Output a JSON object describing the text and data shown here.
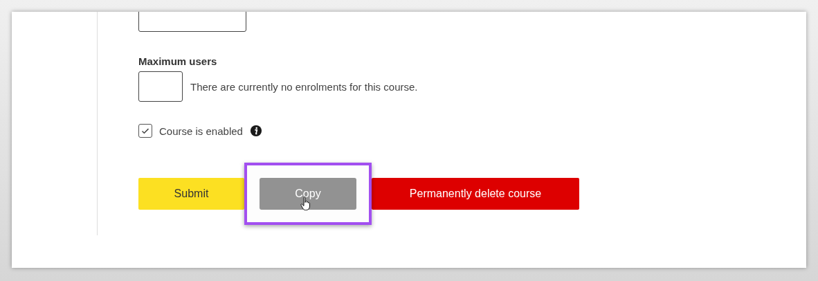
{
  "fields": [
    {
      "kind": "input"
    },
    {
      "kind": "input_with_note",
      "label": "Maximum users",
      "note": "There are currently no enrolments for this course."
    }
  ],
  "checkbox": {
    "label": "Course is enabled",
    "checked": true
  },
  "buttons": [
    {
      "label": "Submit",
      "kind": "submit",
      "highlighted": false
    },
    {
      "label": "Copy",
      "kind": "copy",
      "highlighted": true
    },
    {
      "label": "Permanently delete course",
      "kind": "delete",
      "highlighted": false
    }
  ]
}
